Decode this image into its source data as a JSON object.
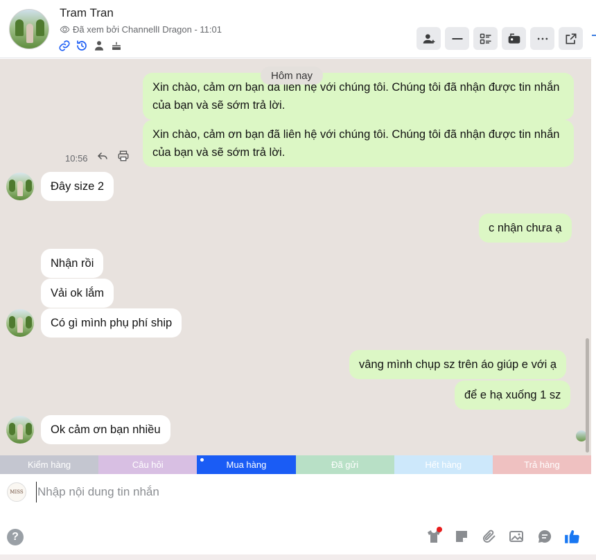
{
  "header": {
    "name": "Tram Tran",
    "seen_text": "Đã xem bởi ChannellI Dragon - 11:01",
    "sub_icons": [
      "link-icon",
      "history-icon",
      "person-icon",
      "birthday-cake-icon"
    ],
    "tools": [
      "add-user-icon",
      "minimize-icon",
      "details-list-icon",
      "mailbox-icon",
      "more-icon",
      "external-link-icon"
    ]
  },
  "chat": {
    "date_label": "Hôm nay",
    "out_msg_1": "Xin chào, cảm ơn bạn đã liên hệ với chúng tôi. Chúng tôi đã nhận được tin nhắn của bạn và sẽ sớm trả lời.",
    "out_msg_2": "Xin chào, cảm ơn bạn đã liên hệ với chúng tôi. Chúng tôi đã nhận được tin nhắn của bạn và sẽ sớm trả lời.",
    "time_1": "10:56",
    "in_msg_1": "Đây size 2",
    "out_msg_3": "c nhận chưa ạ",
    "in_msg_2": "Nhận rồi",
    "in_msg_3": "Vải ok lắm",
    "in_msg_4": "Có gì mình phụ phí ship",
    "out_msg_4": "vâng mình chụp sz trên áo giúp e với ạ",
    "out_msg_5": "để e hạ xuống 1 sz",
    "in_msg_5": "Ok cảm ơn bạn nhiều"
  },
  "tags": [
    {
      "label": "Kiểm hàng",
      "color": "#c4c6d0"
    },
    {
      "label": "Câu hỏi",
      "color": "#d8bfe3"
    },
    {
      "label": "Mua hàng",
      "color": "#1a5cf5"
    },
    {
      "label": "Đã gửi",
      "color": "#b8e0c6"
    },
    {
      "label": "Hết hàng",
      "color": "#cde8fb"
    },
    {
      "label": "Trả hàng",
      "color": "#efc1c1"
    }
  ],
  "composer": {
    "placeholder": "Nhập nội dung tin nhắn",
    "shop_logo_text": "MISS"
  },
  "colors": {
    "outgoing_bubble": "#dcf7c5",
    "incoming_bubble": "#ffffff",
    "chat_background": "#e8e2de",
    "accent": "#1877f2"
  }
}
